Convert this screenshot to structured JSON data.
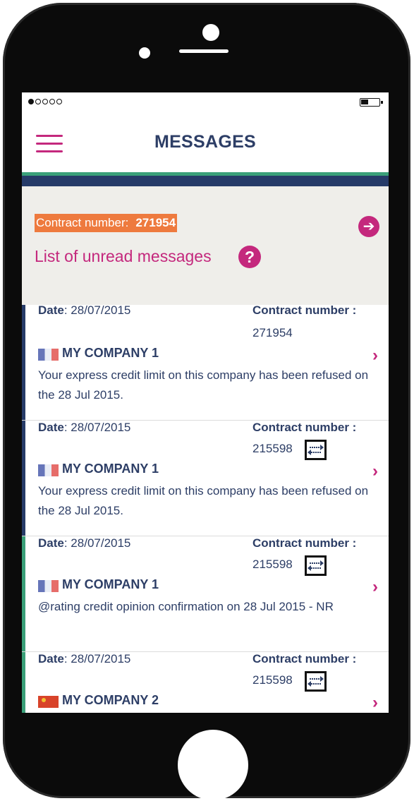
{
  "status_bar": {
    "signal_dots_filled": 1,
    "signal_dots_total": 5
  },
  "header": {
    "title": "MESSAGES",
    "menu_icon": "hamburger-menu-icon"
  },
  "info_panel": {
    "contract_label": "Contract number:",
    "contract_number": "271954",
    "list_title": "List of unread messages",
    "help_glyph": "?",
    "back_icon": "arrow-left-circle-icon"
  },
  "colors": {
    "accent_magenta": "#c4287d",
    "navy": "#263b68",
    "green": "#3aa079",
    "orange_badge": "#ee7a3e",
    "panel_bg": "#efeeea"
  },
  "messages": [
    {
      "date_label": "Date",
      "date": ": 28/07/2015",
      "contract_label": "Contract number :",
      "contract_number": "271954",
      "has_transfer_icon": false,
      "flag": "france-flag-icon",
      "company": "MY COMPANY 1",
      "text": "Your express credit limit on this company has been refused on the 28 Jul 2015.",
      "accent": "navy"
    },
    {
      "date_label": "Date",
      "date": ": 28/07/2015",
      "contract_label": "Contract number :",
      "contract_number": "215598",
      "has_transfer_icon": true,
      "flag": "france-flag-icon",
      "company": "MY COMPANY 1",
      "text": "Your express credit limit on this company has been refused on the 28 Jul 2015.",
      "accent": "navy"
    },
    {
      "date_label": "Date",
      "date": ": 28/07/2015",
      "contract_label": "Contract number :",
      "contract_number": "215598",
      "has_transfer_icon": true,
      "flag": "france-flag-icon",
      "company": "MY COMPANY 1",
      "text": "@rating credit opinion confirmation on 28 Jul 2015 - NR",
      "accent": "green"
    },
    {
      "date_label": "Date",
      "date": ": 28/07/2015",
      "contract_label": "Contract number :",
      "contract_number": "215598",
      "has_transfer_icon": true,
      "flag": "china-flag-icon",
      "company": "MY COMPANY 2",
      "text": "",
      "accent": "green"
    }
  ]
}
